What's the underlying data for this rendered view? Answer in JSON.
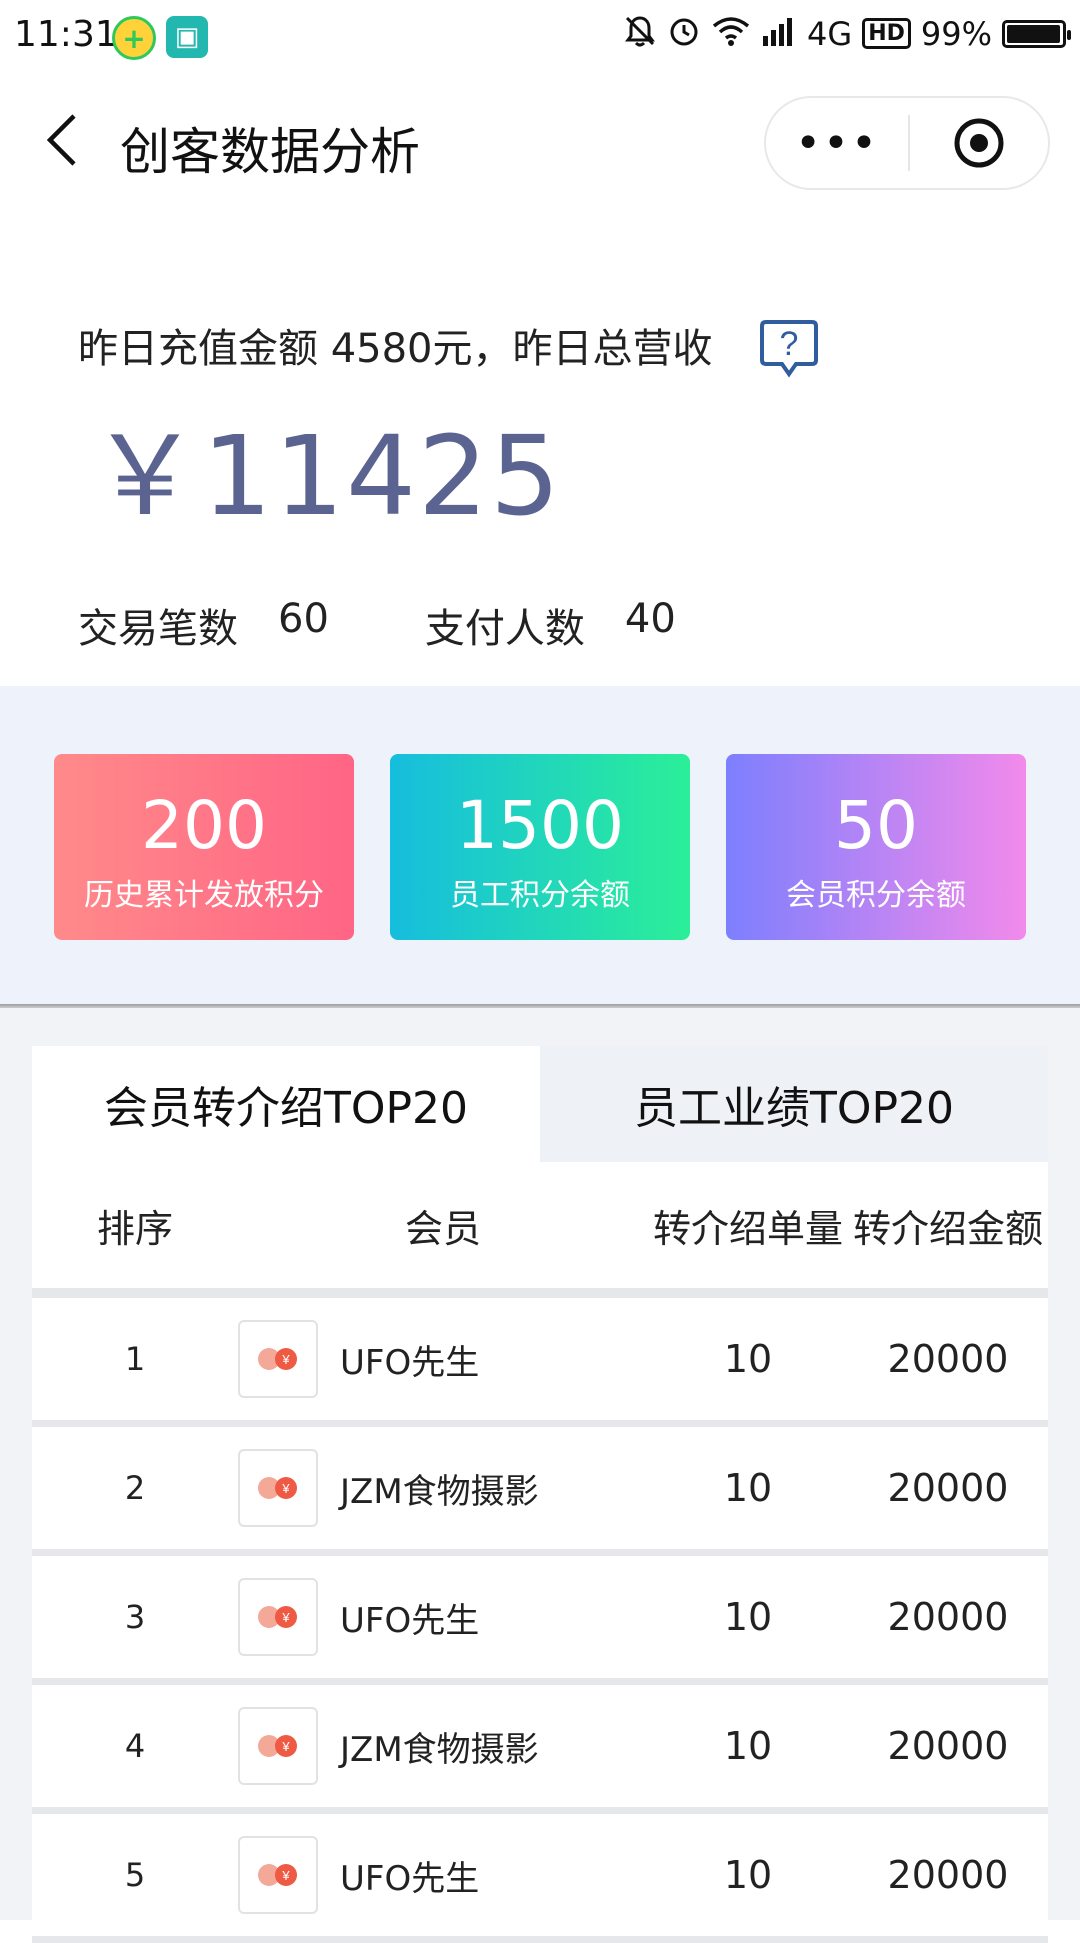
{
  "status_bar": {
    "time": "11:31",
    "network": "4G",
    "hd": "HD",
    "battery": "99%",
    "battery_level": 0.99
  },
  "header": {
    "title": "创客数据分析",
    "more_label": "•••"
  },
  "summary": {
    "line": "昨日充值金额 4580元，昨日总营收",
    "total": "￥11425",
    "trade_label": "交易笔数",
    "trade_value": "60",
    "payer_label": "支付人数",
    "payer_value": "40"
  },
  "cards": [
    {
      "value": "200",
      "label": "历史累计发放积分"
    },
    {
      "value": "1500",
      "label": "员工积分余额"
    },
    {
      "value": "50",
      "label": "会员积分余额"
    }
  ],
  "tabs": [
    {
      "label": "会员转介绍TOP20"
    },
    {
      "label": "员工业绩TOP20"
    }
  ],
  "table": {
    "headers": [
      "排序",
      "会员",
      "转介绍单量",
      "转介绍金额"
    ],
    "rows": [
      {
        "rank": "1",
        "name": "UFO先生",
        "count": "10",
        "amount": "20000"
      },
      {
        "rank": "2",
        "name": "JZM食物摄影",
        "count": "10",
        "amount": "20000"
      },
      {
        "rank": "3",
        "name": "UFO先生",
        "count": "10",
        "amount": "20000"
      },
      {
        "rank": "4",
        "name": "JZM食物摄影",
        "count": "10",
        "amount": "20000"
      },
      {
        "rank": "5",
        "name": "UFO先生",
        "count": "10",
        "amount": "20000"
      }
    ]
  },
  "colors": {
    "amount_color": "#5b6491",
    "card_1": [
      "#ff8a8a",
      "#ff6585"
    ],
    "card_2": [
      "#16bdde",
      "#2bef98"
    ],
    "card_3": [
      "#7d7ffe",
      "#f28aeb"
    ],
    "help_icon": "#2f5d9e"
  }
}
